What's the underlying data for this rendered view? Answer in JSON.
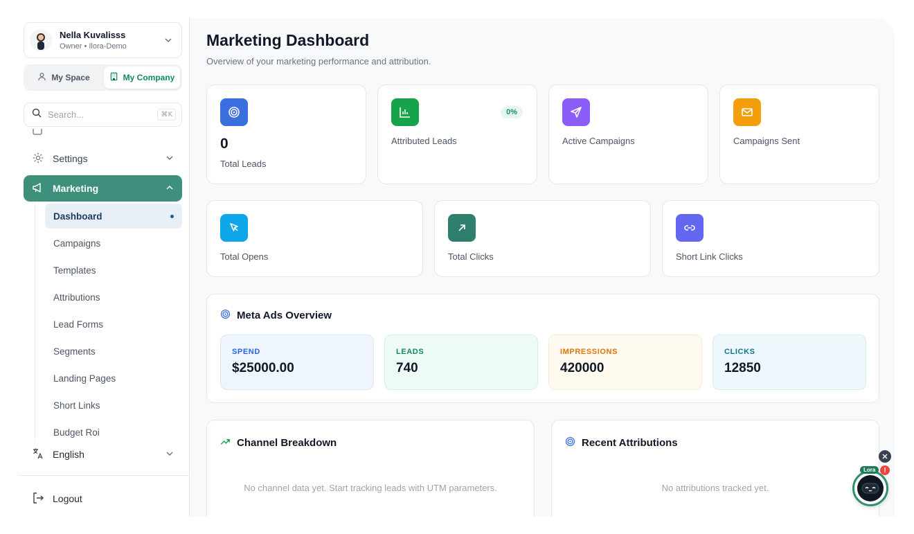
{
  "user": {
    "name": "Nella Kuvalisss",
    "role": "Owner • Ilora-Demo"
  },
  "space_toggle": {
    "my_space": "My Space",
    "my_company": "My Company"
  },
  "search": {
    "placeholder": "Search...",
    "shortcut": "⌘K"
  },
  "nav": {
    "settings": "Settings",
    "marketing": "Marketing",
    "sub_items": [
      "Dashboard",
      "Campaigns",
      "Templates",
      "Attributions",
      "Lead Forms",
      "Segments",
      "Landing Pages",
      "Short Links",
      "Budget Roi"
    ],
    "active_sub": "Dashboard"
  },
  "language": "English",
  "logout": "Logout",
  "page": {
    "title": "Marketing Dashboard",
    "subtitle": "Overview of your marketing performance and attribution."
  },
  "stats_row1": [
    {
      "label": "Total Leads",
      "value": "0",
      "icon": "target-icon",
      "color": "#3b6fe0"
    },
    {
      "label": "Attributed Leads",
      "value": "",
      "badge": "0%",
      "icon": "bar-chart-icon",
      "color": "#16a34a"
    },
    {
      "label": "Active Campaigns",
      "value": "",
      "icon": "send-icon",
      "color": "#8b5cf6"
    },
    {
      "label": "Campaigns Sent",
      "value": "",
      "icon": "mail-icon",
      "color": "#f59e0b"
    }
  ],
  "stats_row2": [
    {
      "label": "Total Opens",
      "icon": "cursor-icon",
      "color": "#0ea5e9"
    },
    {
      "label": "Total Clicks",
      "icon": "arrow-up-right-icon",
      "color": "#2f7f6f"
    },
    {
      "label": "Short Link Clicks",
      "icon": "link-icon",
      "color": "#6366f1"
    }
  ],
  "meta_ads": {
    "title": "Meta Ads Overview",
    "metrics": [
      {
        "label": "SPEND",
        "value": "$25000.00",
        "accent": "#2563eb",
        "bg": "#eff5fd",
        "border": "#dbe7f7"
      },
      {
        "label": "LEADS",
        "value": "740",
        "accent": "#0f8a5f",
        "bg": "#eefaf5",
        "border": "#d5f0e4"
      },
      {
        "label": "IMPRESSIONS",
        "value": "420000",
        "accent": "#d97706",
        "bg": "#fffaf0",
        "border": "#f7ebd3"
      },
      {
        "label": "CLICKS",
        "value": "12850",
        "accent": "#0e7490",
        "bg": "#eef7fb",
        "border": "#d7ebf4"
      }
    ]
  },
  "channel_breakdown": {
    "title": "Channel Breakdown",
    "empty": "No channel data yet. Start tracking leads with UTM parameters."
  },
  "recent_attributions": {
    "title": "Recent Attributions",
    "empty": "No attributions tracked yet."
  },
  "assistant": {
    "tag": "Lora",
    "alert": "!"
  }
}
